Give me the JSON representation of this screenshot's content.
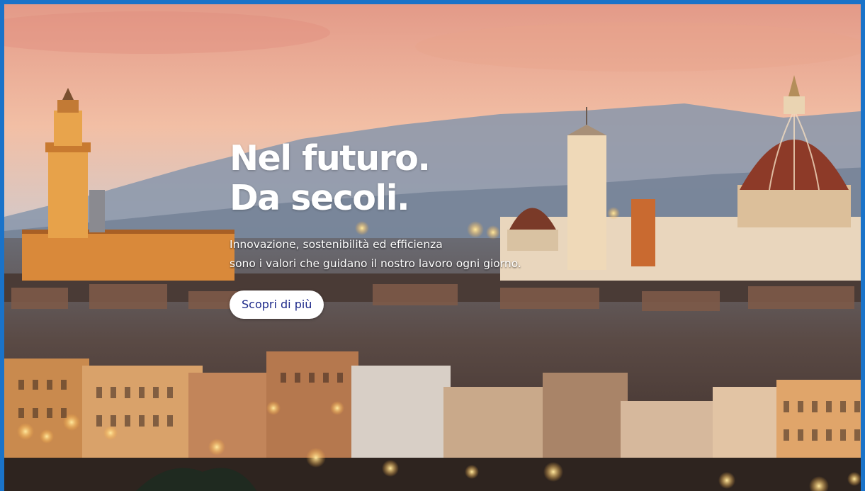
{
  "hero": {
    "headline_line1": "Nel futuro.",
    "headline_line2": "Da secoli.",
    "subtext_line1": "Innovazione, sostenibilità ed efficienza",
    "subtext_line2": "sono i valori che guidano il nostro lavoro ogni giorno.",
    "cta_label": "Scopri di più"
  },
  "colors": {
    "frame_border": "#1a73c9",
    "cta_text": "#1e2a8a",
    "sky_top": "#e7a28c",
    "sky_mid": "#f0c0a4"
  },
  "background": {
    "description_icon": "florence-skyline-photo"
  }
}
